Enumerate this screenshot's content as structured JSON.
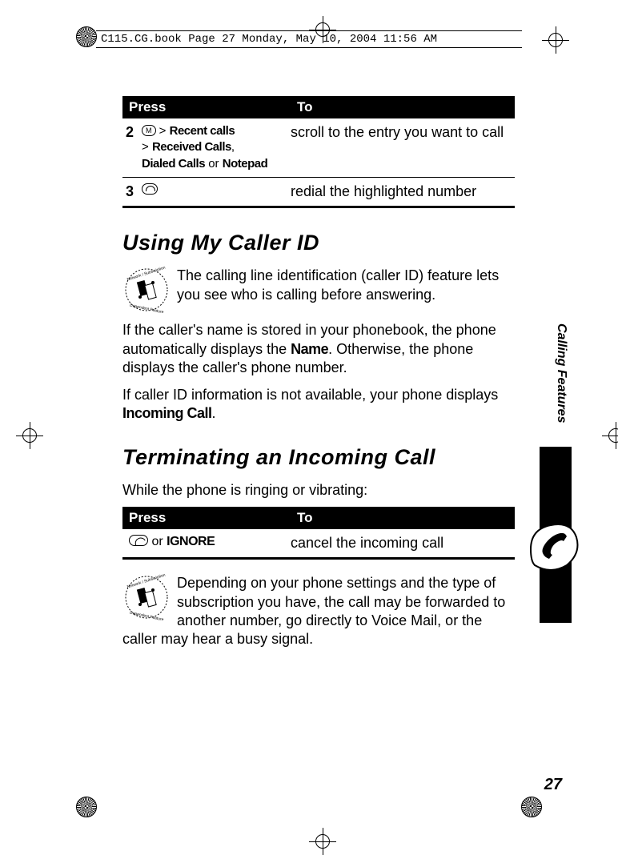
{
  "header_line": "C115.CG.book  Page 27  Monday, May 10, 2004  11:56 AM",
  "table1": {
    "head_press": "Press",
    "head_to": "To",
    "rows": [
      {
        "num": "2",
        "press_prefix": " > ",
        "press_b1": "Recent calls",
        "press_mid": " > ",
        "press_b2": "Received Calls",
        "press_sep": ", ",
        "press_b3": "Dialed Calls",
        "press_or": " or ",
        "press_b4": "Notepad",
        "to": "scroll to the entry you want to call"
      },
      {
        "num": "3",
        "to": "redial the highlighted number"
      }
    ]
  },
  "section1_title": "Using My Caller ID",
  "section1_p1": "The calling line identification (caller ID) feature lets you see who is calling before answering.",
  "section1_p2a": "If the caller's name is stored in your phonebook, the phone automatically displays the ",
  "section1_p2_name": "Name",
  "section1_p2b": ". Otherwise, the phone displays the caller's phone number.",
  "section1_p3a": "If caller ID information is not available, your phone displays ",
  "section1_p3_b": "Incoming Call",
  "section1_p3c": ".",
  "section2_title": "Terminating an Incoming Call",
  "section2_intro": "While the phone is ringing or vibrating:",
  "table2": {
    "head_press": "Press",
    "head_to": "To",
    "row": {
      "press_or": " or ",
      "press_ignore": "IGNORE",
      "to": "cancel the incoming call"
    }
  },
  "section2_p": "Depending on your phone settings and the type of subscription you have, the call may be forwarded to another number, go directly to Voice Mail, or the caller may hear a busy signal.",
  "side_label": "Calling Features",
  "page_number": "27",
  "menu_glyph": "M"
}
